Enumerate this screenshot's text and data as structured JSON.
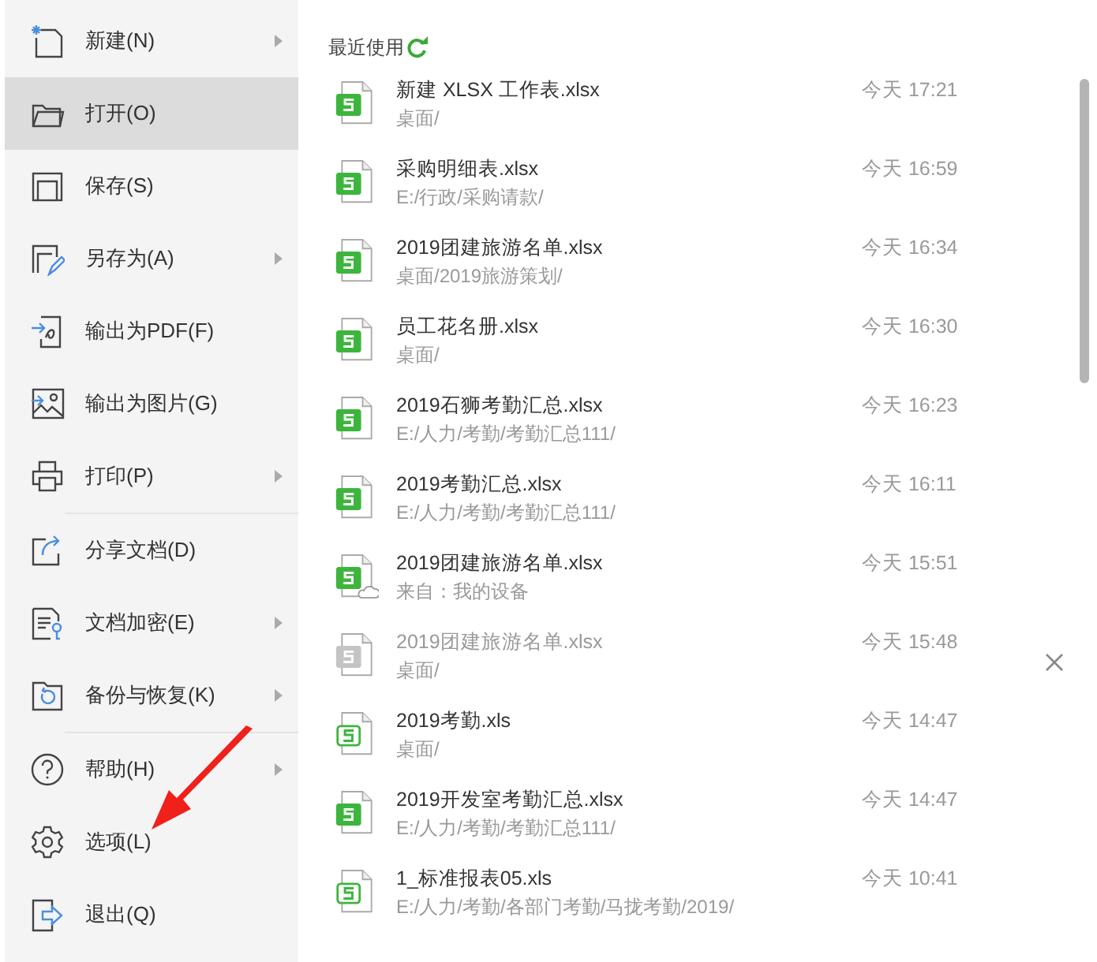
{
  "menu": {
    "groups": [
      {
        "items": [
          {
            "label": "新建(N)",
            "selected": false,
            "submenu": true
          },
          {
            "label": "打开(O)",
            "selected": true,
            "submenu": false
          },
          {
            "label": "保存(S)",
            "selected": false,
            "submenu": false
          },
          {
            "label": "另存为(A)",
            "selected": false,
            "submenu": true
          },
          {
            "label": "输出为PDF(F)",
            "selected": false,
            "submenu": false
          },
          {
            "label": "输出为图片(G)",
            "selected": false,
            "submenu": false
          },
          {
            "label": "打印(P)",
            "selected": false,
            "submenu": true
          }
        ]
      },
      {
        "items": [
          {
            "label": "分享文档(D)",
            "selected": false,
            "submenu": false
          },
          {
            "label": "文档加密(E)",
            "selected": false,
            "submenu": true
          },
          {
            "label": "备份与恢复(K)",
            "selected": false,
            "submenu": true
          }
        ]
      },
      {
        "items": [
          {
            "label": "帮助(H)",
            "selected": false,
            "submenu": true
          },
          {
            "label": "选项(L)",
            "selected": false,
            "submenu": false
          },
          {
            "label": "退出(Q)",
            "selected": false,
            "submenu": false
          }
        ]
      }
    ]
  },
  "recent": {
    "title": "最近使用",
    "files": [
      {
        "kind": "xlsx",
        "name": "新建 XLSX 工作表.xlsx",
        "path": "桌面/",
        "time": "今天 17:21",
        "unavailable": false,
        "cloud": false,
        "hovered": false
      },
      {
        "kind": "xlsx",
        "name": "采购明细表.xlsx",
        "path": "E:/行政/采购请款/",
        "time": "今天 16:59",
        "unavailable": false,
        "cloud": false,
        "hovered": false
      },
      {
        "kind": "xlsx",
        "name": "2019团建旅游名单.xlsx",
        "path": "桌面/2019旅游策划/",
        "time": "今天 16:34",
        "unavailable": false,
        "cloud": false,
        "hovered": false
      },
      {
        "kind": "xlsx",
        "name": "员工花名册.xlsx",
        "path": "桌面/",
        "time": "今天 16:30",
        "unavailable": false,
        "cloud": false,
        "hovered": false
      },
      {
        "kind": "xlsx",
        "name": "2019石狮考勤汇总.xlsx",
        "path": "E:/人力/考勤/考勤汇总111/",
        "time": "今天 16:23",
        "unavailable": false,
        "cloud": false,
        "hovered": false
      },
      {
        "kind": "xlsx",
        "name": "2019考勤汇总.xlsx",
        "path": "E:/人力/考勤/考勤汇总111/",
        "time": "今天 16:11",
        "unavailable": false,
        "cloud": false,
        "hovered": false
      },
      {
        "kind": "xlsx",
        "name": "2019团建旅游名单.xlsx",
        "path": "来自：我的设备",
        "time": "今天 15:51",
        "unavailable": false,
        "cloud": true,
        "hovered": false
      },
      {
        "kind": "xlsx",
        "name": "2019团建旅游名单.xlsx",
        "path": "桌面/",
        "time": "今天 15:48",
        "unavailable": true,
        "cloud": false,
        "hovered": true
      },
      {
        "kind": "xls",
        "name": "2019考勤.xls",
        "path": "桌面/",
        "time": "今天 14:47",
        "unavailable": false,
        "cloud": false,
        "hovered": false
      },
      {
        "kind": "xlsx",
        "name": "2019开发室考勤汇总.xlsx",
        "path": "E:/人力/考勤/考勤汇总111/",
        "time": "今天 14:47",
        "unavailable": false,
        "cloud": false,
        "hovered": false
      },
      {
        "kind": "xls",
        "name": "1_标准报表05.xls",
        "path": "E:/人力/考勤/各部门考勤/马拢考勤/2019/",
        "time": "今天 10:41",
        "unavailable": false,
        "cloud": false,
        "hovered": false
      }
    ]
  }
}
